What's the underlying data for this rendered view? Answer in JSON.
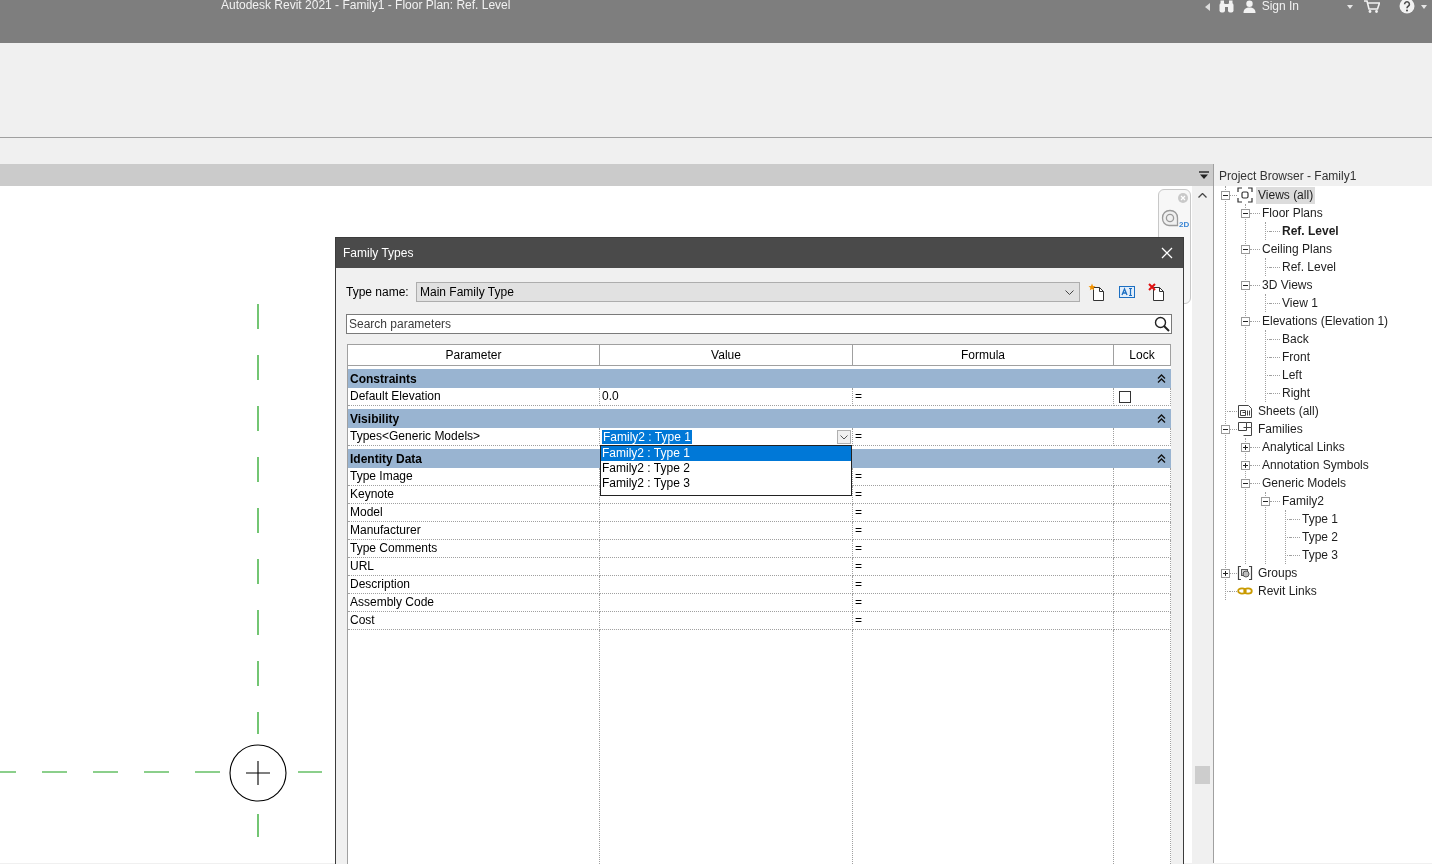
{
  "window": {
    "title": "Autodesk Revit 2021 - Family1 - Floor Plan: Ref. Level"
  },
  "title_bar": {
    "sign_in": "Sign In"
  },
  "navigation_bar": {
    "wheel_label": "2D"
  },
  "dialog": {
    "title": "Family Types",
    "type_name": {
      "label": "Type name:",
      "value": "Main Family Type"
    },
    "search": {
      "placeholder": "Search parameters"
    },
    "table": {
      "columns": [
        "Parameter",
        "Value",
        "Formula",
        "Lock"
      ],
      "groups": [
        {
          "name": "Constraints",
          "expanded": true,
          "rows": [
            {
              "parameter": "Default Elevation",
              "kind": "text",
              "value": "0.0",
              "formula": "=",
              "locked": false
            }
          ]
        },
        {
          "name": "Visibility",
          "expanded": true,
          "rows": [
            {
              "parameter": "Types<Generic Models>",
              "kind": "dropdown",
              "value": "Family2 : Type 1",
              "focused": true,
              "expanded": true,
              "formula": "=",
              "options": [
                {
                  "label": "Family2 : Type 1",
                  "selected": true
                },
                {
                  "label": "Family2 : Type 2",
                  "selected": false
                },
                {
                  "label": "Family2 : Type 3",
                  "selected": false
                }
              ]
            }
          ]
        },
        {
          "name": "Identity Data",
          "expanded": true,
          "rows": [
            {
              "parameter": "Type Image",
              "kind": "text",
              "formula": "="
            },
            {
              "parameter": "Keynote",
              "kind": "text",
              "formula": "="
            },
            {
              "parameter": "Model",
              "kind": "text",
              "formula": "="
            },
            {
              "parameter": "Manufacturer",
              "kind": "text",
              "formula": "="
            },
            {
              "parameter": "Type Comments",
              "kind": "text",
              "formula": "="
            },
            {
              "parameter": "URL",
              "kind": "text",
              "formula": "="
            },
            {
              "parameter": "Description",
              "kind": "text",
              "formula": "="
            },
            {
              "parameter": "Assembly Code",
              "kind": "text",
              "formula": "="
            },
            {
              "parameter": "Cost",
              "kind": "text",
              "formula": "="
            }
          ]
        }
      ]
    }
  },
  "project_browser": {
    "title": "Project Browser - Family1",
    "tree": [
      {
        "label": "Views (all)",
        "kind": "views",
        "expanded": true,
        "selected": true,
        "current": false,
        "children": [
          {
            "label": "Floor Plans",
            "expanded": true,
            "selected": false,
            "current": false,
            "children": [
              {
                "label": "Ref. Level",
                "selected": false,
                "current": true
              }
            ]
          },
          {
            "label": "Ceiling Plans",
            "expanded": true,
            "selected": false,
            "current": false,
            "children": [
              {
                "label": "Ref. Level",
                "selected": false,
                "current": false
              }
            ]
          },
          {
            "label": "3D Views",
            "expanded": true,
            "selected": false,
            "current": false,
            "children": [
              {
                "label": "View 1",
                "selected": false,
                "current": false
              }
            ]
          },
          {
            "label": "Elevations (Elevation 1)",
            "expanded": true,
            "selected": false,
            "current": false,
            "children": [
              {
                "label": "Back",
                "selected": false,
                "current": false
              },
              {
                "label": "Front",
                "selected": false,
                "current": false
              },
              {
                "label": "Left",
                "selected": false,
                "current": false
              },
              {
                "label": "Right",
                "selected": false,
                "current": false
              }
            ]
          }
        ]
      },
      {
        "label": "Sheets (all)",
        "kind": "sheets",
        "selected": false,
        "current": false
      },
      {
        "label": "Families",
        "kind": "families",
        "expanded": true,
        "selected": false,
        "current": false,
        "children": [
          {
            "label": "Analytical Links",
            "expanded": false,
            "selected": false,
            "current": false
          },
          {
            "label": "Annotation Symbols",
            "expanded": false,
            "selected": false,
            "current": false
          },
          {
            "label": "Generic Models",
            "expanded": true,
            "selected": false,
            "current": false,
            "children": [
              {
                "label": "Family2",
                "expanded": true,
                "selected": false,
                "current": false,
                "children": [
                  {
                    "label": "Type 1",
                    "selected": false,
                    "current": false
                  },
                  {
                    "label": "Type 2",
                    "selected": false,
                    "current": false
                  },
                  {
                    "label": "Type 3",
                    "selected": false,
                    "current": false
                  }
                ]
              }
            ]
          }
        ]
      },
      {
        "label": "Groups",
        "kind": "groups",
        "expanded": false,
        "selected": false,
        "current": false
      },
      {
        "label": "Revit Links",
        "kind": "links",
        "selected": false,
        "current": false
      }
    ]
  }
}
